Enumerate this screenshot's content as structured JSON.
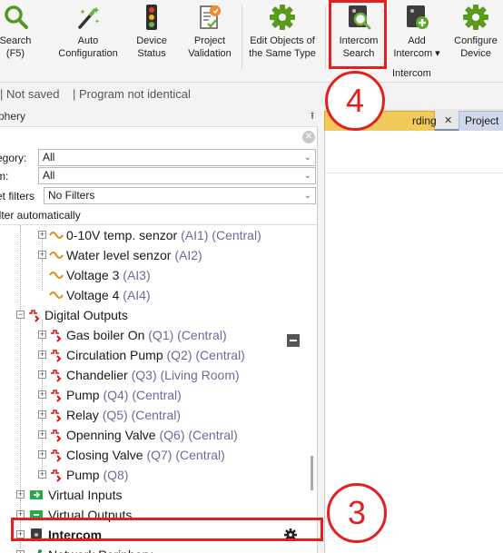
{
  "ribbon": {
    "buttons": [
      {
        "label": "Search\n(F5)",
        "icon": "search-icon"
      },
      {
        "label": "Auto\nConfiguration",
        "icon": "magic-wand-icon"
      },
      {
        "label": "Device\nStatus",
        "icon": "traffic-light-icon"
      },
      {
        "label": "Project\nValidation",
        "icon": "document-check-icon"
      },
      {
        "label": "Edit Objects of\nthe Same Type",
        "icon": "gear-icon"
      },
      {
        "label": "Intercom\nSearch",
        "icon": "intercom-search-icon"
      },
      {
        "label": "Add\nIntercom ▾",
        "icon": "intercom-add-icon"
      },
      {
        "label": "Configure\nDevice",
        "icon": "gear-icon"
      }
    ],
    "group_label": "Intercom"
  },
  "status": {
    "parts": [
      "| Not saved",
      "| Program not identical"
    ]
  },
  "panel": {
    "title": "phery",
    "pin": "⭱",
    "filters": {
      "category_label": "egory:",
      "category_value": "All",
      "room_label": "m:",
      "room_value": "All",
      "preset_label": "et filters",
      "preset_value": "No Filters",
      "auto_label": "ilter automatically"
    }
  },
  "tree": {
    "items": [
      {
        "name": "0-10V temp. senzor",
        "sub": "(AI1) (Central)"
      },
      {
        "name": "Water level senzor",
        "sub": "(AI2)"
      },
      {
        "name": "Voltage 3",
        "sub": "(AI3)"
      },
      {
        "name": "Voltage 4",
        "sub": "(AI4)"
      },
      {
        "name": "Digital Outputs",
        "sub": ""
      },
      {
        "name": "Gas boiler On",
        "sub": "(Q1) (Central)"
      },
      {
        "name": "Circulation Pump",
        "sub": "(Q2) (Central)"
      },
      {
        "name": "Chandelier",
        "sub": "(Q3) (Living Room)"
      },
      {
        "name": "Pump",
        "sub": "(Q4) (Central)"
      },
      {
        "name": "Relay",
        "sub": "(Q5) (Central)"
      },
      {
        "name": "Openning Valve",
        "sub": "(Q6) (Central)"
      },
      {
        "name": "Closing Valve",
        "sub": "(Q7) (Central)"
      },
      {
        "name": "Pump",
        "sub": "(Q8)"
      },
      {
        "name": "Virtual Inputs",
        "sub": ""
      },
      {
        "name": "Virtual Outputs",
        "sub": ""
      },
      {
        "name": "Intercom",
        "sub": ""
      },
      {
        "name": "Network Periphery",
        "sub": ""
      }
    ]
  },
  "tabs": [
    {
      "label": "rding",
      "close": "✕"
    },
    {
      "label": "Project"
    }
  ],
  "callouts": {
    "four": "4",
    "three": "3"
  },
  "colors": {
    "ribbon_green": "#5a9a1c",
    "highlight_red": "#e41f1f",
    "tab_active": "#f2c95a"
  }
}
